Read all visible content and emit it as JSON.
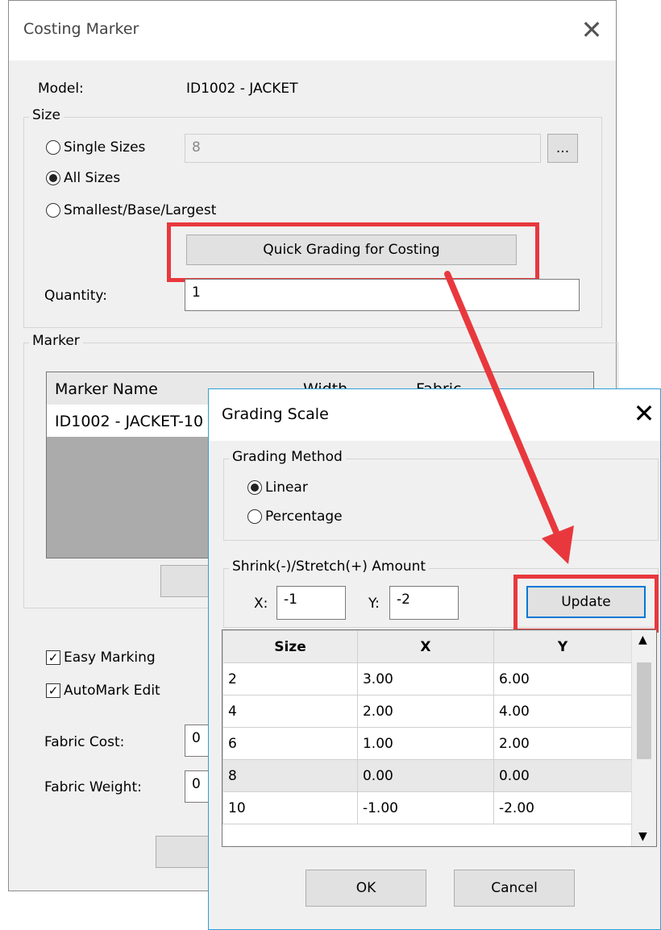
{
  "costing_marker": {
    "title": "Costing Marker",
    "close_glyph": "✕",
    "model_label": "Model:",
    "model_value": "ID1002 - JACKET",
    "size_group": "Size",
    "radio_single": "Single Sizes",
    "radio_all": "All Sizes",
    "radio_sbl": "Smallest/Base/Largest",
    "selected_radio": "All Sizes",
    "single_size_value": "8",
    "browse_button": "...",
    "quick_grading_button": "Quick Grading for Costing",
    "quantity_label": "Quantity:",
    "quantity_value": "1",
    "marker_group": "Marker",
    "marker_columns": [
      "Marker Name",
      "Width",
      "Fabric"
    ],
    "marker_rows": [
      "ID1002 - JACKET-10"
    ],
    "easy_marking": "Easy Marking",
    "automark_edit": "AutoMark Edit",
    "fabric_cost_label": "Fabric Cost:",
    "fabric_cost_value": "0",
    "fabric_weight_label": "Fabric Weight:",
    "fabric_weight_value": "0"
  },
  "grading_scale": {
    "title": "Grading Scale",
    "close_glyph": "✕",
    "method_group": "Grading Method",
    "radio_linear": "Linear",
    "radio_percentage": "Percentage",
    "selected_method": "Linear",
    "amount_group": "Shrink(-)/Stretch(+) Amount",
    "x_label": "X:",
    "x_value": "-1",
    "y_label": "Y:",
    "y_value": "-2",
    "update_button": "Update",
    "table_headers": [
      "Size",
      "X",
      "Y"
    ],
    "table_rows": [
      [
        "2",
        "3.00",
        "6.00"
      ],
      [
        "4",
        "2.00",
        "4.00"
      ],
      [
        "6",
        "1.00",
        "2.00"
      ],
      [
        "8",
        "0.00",
        "0.00"
      ],
      [
        "10",
        "-1.00",
        "-2.00"
      ]
    ],
    "ok_button": "OK",
    "cancel_button": "Cancel"
  },
  "colors": {
    "highlight": "#e8383d",
    "dialog_border": "#2ea0d8",
    "focus_border": "#0078d7"
  }
}
